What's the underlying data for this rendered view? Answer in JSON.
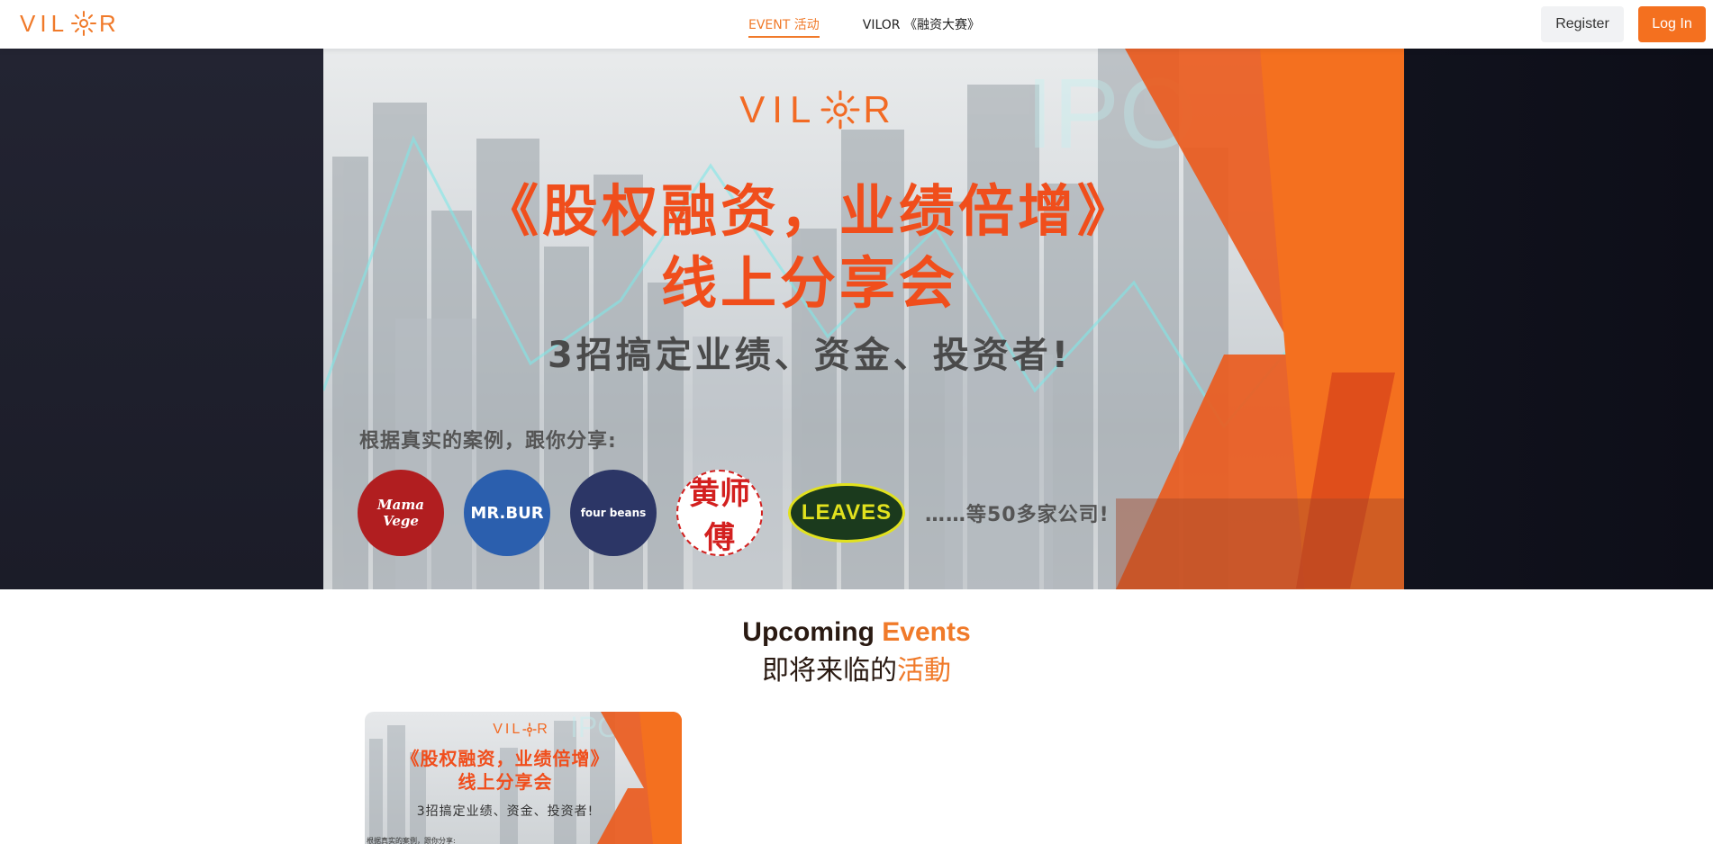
{
  "brand": {
    "logo_text_left": "VIL",
    "logo_text_right": "R"
  },
  "nav": {
    "items": [
      {
        "label": "EVENT 活动",
        "active": true
      },
      {
        "label": "VILOR 《融资大赛》",
        "active": false
      }
    ]
  },
  "auth": {
    "register_label": "Register",
    "login_label": "Log In"
  },
  "hero": {
    "logo_text_left": "VIL",
    "logo_text_right": "R",
    "title_line1": "《股权融资，业绩倍增》",
    "title_line2": "线上分享会",
    "subtitle": "3招搞定业绩、资金、投资者!",
    "note": "根据真实的案例，跟你分享:",
    "brands": [
      "Mama Vege",
      "MR.BUR",
      "four beans",
      "黄师傅",
      "LEAVES"
    ],
    "more": "……等50多家公司!"
  },
  "section": {
    "title_en_part1": "Upcoming ",
    "title_en_part2": "Events",
    "title_zh_part1": "即将来临的",
    "title_zh_part2": "活動"
  },
  "events": [
    {
      "logo_text_left": "VIL",
      "logo_text_right": "R",
      "title_line1": "《股权融资，业绩倍增》",
      "title_line2": "线上分享会",
      "subtitle": "3招搞定业绩、资金、投资者!",
      "note": "根据真实的案例，跟你分享:"
    }
  ],
  "colors": {
    "accent": "#f07a2a",
    "login_bg": "#f4701f",
    "title_red": "#f04e1c"
  }
}
